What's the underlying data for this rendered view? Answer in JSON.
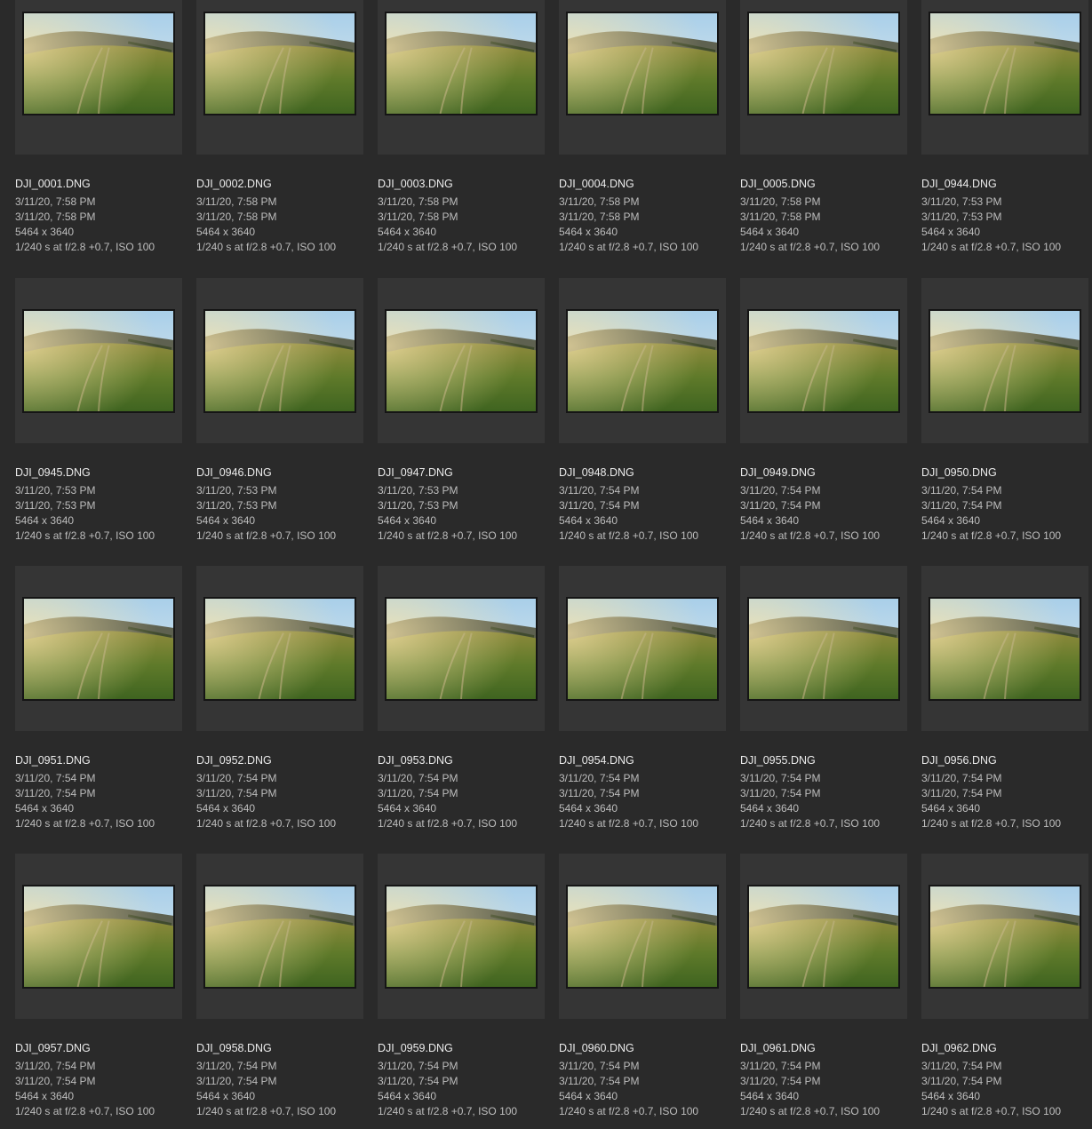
{
  "files": [
    {
      "name": "DJI_0001.DNG",
      "created": "3/11/20, 7:58 PM",
      "modified": "3/11/20, 7:58 PM",
      "dimensions": "5464 x 3640",
      "exposure": "1/240 s at f/2.8 +0.7, ISO 100"
    },
    {
      "name": "DJI_0002.DNG",
      "created": "3/11/20, 7:58 PM",
      "modified": "3/11/20, 7:58 PM",
      "dimensions": "5464 x 3640",
      "exposure": "1/240 s at f/2.8 +0.7, ISO 100"
    },
    {
      "name": "DJI_0003.DNG",
      "created": "3/11/20, 7:58 PM",
      "modified": "3/11/20, 7:58 PM",
      "dimensions": "5464 x 3640",
      "exposure": "1/240 s at f/2.8 +0.7, ISO 100"
    },
    {
      "name": "DJI_0004.DNG",
      "created": "3/11/20, 7:58 PM",
      "modified": "3/11/20, 7:58 PM",
      "dimensions": "5464 x 3640",
      "exposure": "1/240 s at f/2.8 +0.7, ISO 100"
    },
    {
      "name": "DJI_0005.DNG",
      "created": "3/11/20, 7:58 PM",
      "modified": "3/11/20, 7:58 PM",
      "dimensions": "5464 x 3640",
      "exposure": "1/240 s at f/2.8 +0.7, ISO 100"
    },
    {
      "name": "DJI_0944.DNG",
      "created": "3/11/20, 7:53 PM",
      "modified": "3/11/20, 7:53 PM",
      "dimensions": "5464 x 3640",
      "exposure": "1/240 s at f/2.8 +0.7, ISO 100"
    },
    {
      "name": "DJI_0945.DNG",
      "created": "3/11/20, 7:53 PM",
      "modified": "3/11/20, 7:53 PM",
      "dimensions": "5464 x 3640",
      "exposure": "1/240 s at f/2.8 +0.7, ISO 100"
    },
    {
      "name": "DJI_0946.DNG",
      "created": "3/11/20, 7:53 PM",
      "modified": "3/11/20, 7:53 PM",
      "dimensions": "5464 x 3640",
      "exposure": "1/240 s at f/2.8 +0.7, ISO 100"
    },
    {
      "name": "DJI_0947.DNG",
      "created": "3/11/20, 7:53 PM",
      "modified": "3/11/20, 7:53 PM",
      "dimensions": "5464 x 3640",
      "exposure": "1/240 s at f/2.8 +0.7, ISO 100"
    },
    {
      "name": "DJI_0948.DNG",
      "created": "3/11/20, 7:54 PM",
      "modified": "3/11/20, 7:54 PM",
      "dimensions": "5464 x 3640",
      "exposure": "1/240 s at f/2.8 +0.7, ISO 100"
    },
    {
      "name": "DJI_0949.DNG",
      "created": "3/11/20, 7:54 PM",
      "modified": "3/11/20, 7:54 PM",
      "dimensions": "5464 x 3640",
      "exposure": "1/240 s at f/2.8 +0.7, ISO 100"
    },
    {
      "name": "DJI_0950.DNG",
      "created": "3/11/20, 7:54 PM",
      "modified": "3/11/20, 7:54 PM",
      "dimensions": "5464 x 3640",
      "exposure": "1/240 s at f/2.8 +0.7, ISO 100"
    },
    {
      "name": "DJI_0951.DNG",
      "created": "3/11/20, 7:54 PM",
      "modified": "3/11/20, 7:54 PM",
      "dimensions": "5464 x 3640",
      "exposure": "1/240 s at f/2.8 +0.7, ISO 100"
    },
    {
      "name": "DJI_0952.DNG",
      "created": "3/11/20, 7:54 PM",
      "modified": "3/11/20, 7:54 PM",
      "dimensions": "5464 x 3640",
      "exposure": "1/240 s at f/2.8 +0.7, ISO 100"
    },
    {
      "name": "DJI_0953.DNG",
      "created": "3/11/20, 7:54 PM",
      "modified": "3/11/20, 7:54 PM",
      "dimensions": "5464 x 3640",
      "exposure": "1/240 s at f/2.8 +0.7, ISO 100"
    },
    {
      "name": "DJI_0954.DNG",
      "created": "3/11/20, 7:54 PM",
      "modified": "3/11/20, 7:54 PM",
      "dimensions": "5464 x 3640",
      "exposure": "1/240 s at f/2.8 +0.7, ISO 100"
    },
    {
      "name": "DJI_0955.DNG",
      "created": "3/11/20, 7:54 PM",
      "modified": "3/11/20, 7:54 PM",
      "dimensions": "5464 x 3640",
      "exposure": "1/240 s at f/2.8 +0.7, ISO 100"
    },
    {
      "name": "DJI_0956.DNG",
      "created": "3/11/20, 7:54 PM",
      "modified": "3/11/20, 7:54 PM",
      "dimensions": "5464 x 3640",
      "exposure": "1/240 s at f/2.8 +0.7, ISO 100"
    },
    {
      "name": "DJI_0957.DNG",
      "created": "3/11/20, 7:54 PM",
      "modified": "3/11/20, 7:54 PM",
      "dimensions": "5464 x 3640",
      "exposure": "1/240 s at f/2.8 +0.7, ISO 100"
    },
    {
      "name": "DJI_0958.DNG",
      "created": "3/11/20, 7:54 PM",
      "modified": "3/11/20, 7:54 PM",
      "dimensions": "5464 x 3640",
      "exposure": "1/240 s at f/2.8 +0.7, ISO 100"
    },
    {
      "name": "DJI_0959.DNG",
      "created": "3/11/20, 7:54 PM",
      "modified": "3/11/20, 7:54 PM",
      "dimensions": "5464 x 3640",
      "exposure": "1/240 s at f/2.8 +0.7, ISO 100"
    },
    {
      "name": "DJI_0960.DNG",
      "created": "3/11/20, 7:54 PM",
      "modified": "3/11/20, 7:54 PM",
      "dimensions": "5464 x 3640",
      "exposure": "1/240 s at f/2.8 +0.7, ISO 100"
    },
    {
      "name": "DJI_0961.DNG",
      "created": "3/11/20, 7:54 PM",
      "modified": "3/11/20, 7:54 PM",
      "dimensions": "5464 x 3640",
      "exposure": "1/240 s at f/2.8 +0.7, ISO 100"
    },
    {
      "name": "DJI_0962.DNG",
      "created": "3/11/20, 7:54 PM",
      "modified": "3/11/20, 7:54 PM",
      "dimensions": "5464 x 3640",
      "exposure": "1/240 s at f/2.8 +0.7, ISO 100"
    }
  ]
}
